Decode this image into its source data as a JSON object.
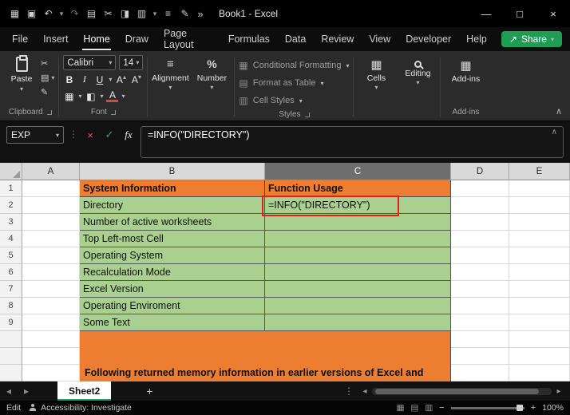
{
  "colors": {
    "orange": "#ED7D31",
    "green": "#A9D08E",
    "red_border": "#E0201C",
    "share_green": "#1F9D55",
    "tab_underline": "#E8E8E8",
    "sheet_accent": "#1EA15A"
  },
  "title_bar": {
    "title": "Book1 - Excel",
    "icons": [
      {
        "name": "app-grid-icon",
        "glyph": "▦"
      },
      {
        "name": "save-icon",
        "glyph": "▣"
      },
      {
        "name": "undo-icon",
        "glyph": "↶"
      },
      {
        "name": "undo-dropdown-icon",
        "glyph": "▾"
      },
      {
        "name": "redo-icon",
        "glyph": "↷"
      },
      {
        "name": "copy-icon",
        "glyph": "▤"
      },
      {
        "name": "cut-icon",
        "glyph": "✂"
      },
      {
        "name": "paste-icon",
        "glyph": "◨"
      },
      {
        "name": "chart-icon",
        "glyph": "▥"
      },
      {
        "name": "chart-dropdown-icon",
        "glyph": "▾"
      },
      {
        "name": "print-icon",
        "glyph": "≡"
      },
      {
        "name": "draw-icon",
        "glyph": "✎"
      }
    ],
    "overflow": "»",
    "minimize": "—",
    "maximize": "□",
    "close": "×"
  },
  "tabs": {
    "items": [
      "File",
      "Insert",
      "Home",
      "Draw",
      "Page Layout",
      "Formulas",
      "Data",
      "Review",
      "View",
      "Developer",
      "Help"
    ],
    "active": "Home"
  },
  "share": {
    "label": "Share",
    "icon": "↗",
    "arrow": "▾"
  },
  "ui": {
    "dropdown": "▾",
    "up": "▴",
    "collapse": "∧",
    "dots": "⋮",
    "alignment_icon": "≡",
    "number_icon": "%",
    "borders_icon": "▦",
    "fill_icon": "◧",
    "fontcolor_icon": "A",
    "grow_font": "A",
    "shrink_font": "A",
    "cf_icon": "▦",
    "table_icon": "▤",
    "cellstyles_icon": "▥",
    "cells_icon": "▦",
    "addins_icon": "▦",
    "cut_icon": "✂",
    "copy_icon": "▤",
    "painter_icon": "✎",
    "prev_arrow": "◂",
    "next_arrow": "▸",
    "view_normal": "▦",
    "view_layout": "▤",
    "view_break": "▥"
  },
  "ribbon": {
    "paste_label": "Paste",
    "clipboard_group": "Clipboard",
    "font_group": "Font",
    "styles_group": "Styles",
    "addins_group": "Add-ins",
    "font_name": "Calibri",
    "font_size": "14",
    "bold": "B",
    "italic": "I",
    "underline": "U",
    "alignment_label": "Alignment",
    "number_label": "Number",
    "conditional_formatting": "Conditional Formatting",
    "format_as_table": "Format as Table",
    "cell_styles": "Cell Styles",
    "cells_label": "Cells",
    "editing_label": "Editing",
    "addins_label": "Add-ins"
  },
  "formula_bar": {
    "name_box": "EXP",
    "cancel": "×",
    "enter": "✓",
    "fx": "fx",
    "formula": "=INFO(\"DIRECTORY\")"
  },
  "grid": {
    "columns": [
      "A",
      "B",
      "C",
      "D",
      "E"
    ],
    "selected_column": "C",
    "rows": [
      {
        "n": "1",
        "b": "System Information",
        "c": "Function Usage"
      },
      {
        "n": "2",
        "b": "Directory",
        "c": "=INFO(\"DIRECTORY\")"
      },
      {
        "n": "3",
        "b": "Number of active worksheets",
        "c": ""
      },
      {
        "n": "4",
        "b": "Top Left-most Cell",
        "c": ""
      },
      {
        "n": "5",
        "b": "Operating System",
        "c": ""
      },
      {
        "n": "6",
        "b": "Recalculation Mode",
        "c": ""
      },
      {
        "n": "7",
        "b": "Excel Version",
        "c": ""
      },
      {
        "n": "8",
        "b": "Operating Enviroment",
        "c": ""
      },
      {
        "n": "9",
        "b": "Some Text",
        "c": ""
      }
    ],
    "note": "Following returned memory information in earlier versions of Excel and"
  },
  "sheet_bar": {
    "active_sheet": "Sheet2",
    "add_label": "+"
  },
  "status_bar": {
    "mode": "Edit",
    "accessibility": "Accessibility: Investigate",
    "zoom_out": "−",
    "zoom_in": "+",
    "zoom": "100%"
  }
}
